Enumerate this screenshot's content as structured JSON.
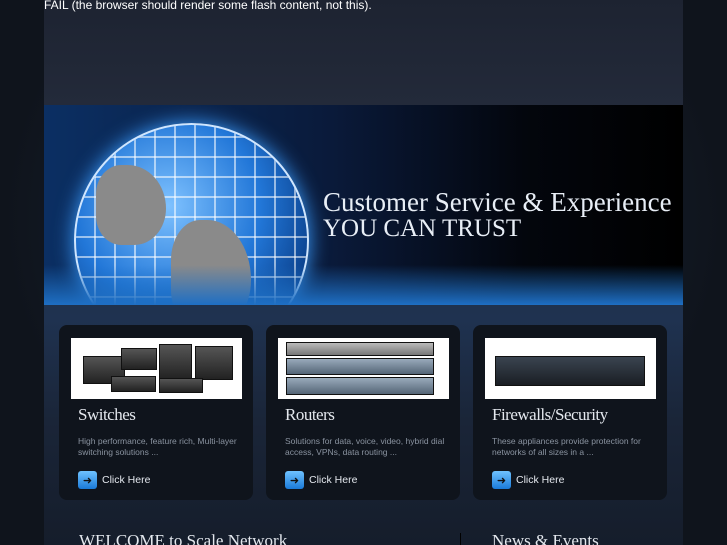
{
  "fail_message": "FAIL (the browser should render some flash content, not this).",
  "banner": {
    "line1": "Customer Service & Experience",
    "line2": "YOU CAN TRUST"
  },
  "cards": [
    {
      "title": "Switches",
      "description": "High performance, feature rich, Multi-layer switching solutions ...",
      "link": "Click Here"
    },
    {
      "title": "Routers",
      "description": "Solutions for data, voice, video, hybrid dial access, VPNs, data routing ...",
      "link": "Click Here"
    },
    {
      "title": "Firewalls/Security",
      "description": "These appliances provide protection for networks of all sizes in a ...",
      "link": "Click Here"
    }
  ],
  "sections": {
    "welcome": "WELCOME to Scale Network",
    "news": "News & Events"
  }
}
